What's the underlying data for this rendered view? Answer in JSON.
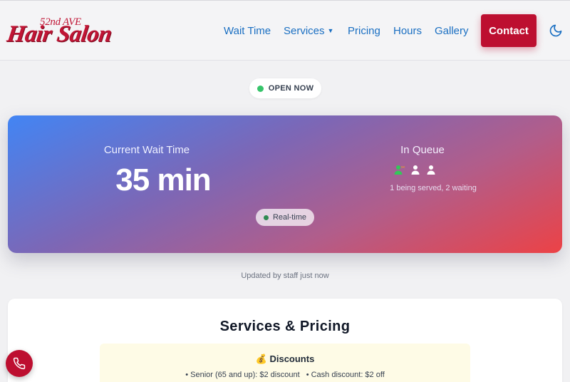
{
  "brand": {
    "logo_top": "52nd AVE",
    "logo_main": "Hair Salon"
  },
  "nav": {
    "items": [
      {
        "label": "Wait Time"
      },
      {
        "label": "Services"
      },
      {
        "label": "Pricing"
      },
      {
        "label": "Hours"
      },
      {
        "label": "Gallery"
      }
    ],
    "contact_label": "Contact",
    "theme_icon": "moon-icon"
  },
  "status": {
    "label": "OPEN NOW",
    "color": "#36c46a"
  },
  "wait": {
    "title": "Current Wait Time",
    "value": "35 min",
    "queue_title": "In Queue",
    "queue_summary": "1 being served, 2 waiting",
    "realtime_label": "Real-time",
    "updated_text": "Updated by staff just now",
    "gradient": [
      "#4285f4",
      "#ec4246"
    ]
  },
  "services": {
    "title": "Services & Pricing",
    "discounts": {
      "title": "💰 Discounts",
      "items": [
        "• Senior (65 and up): $2 discount",
        "• Cash discount: $2 off"
      ]
    }
  },
  "colors": {
    "brand_red": "#bd0f30",
    "link_blue": "#1a6fc2"
  },
  "fab": {
    "icon": "phone-icon"
  }
}
